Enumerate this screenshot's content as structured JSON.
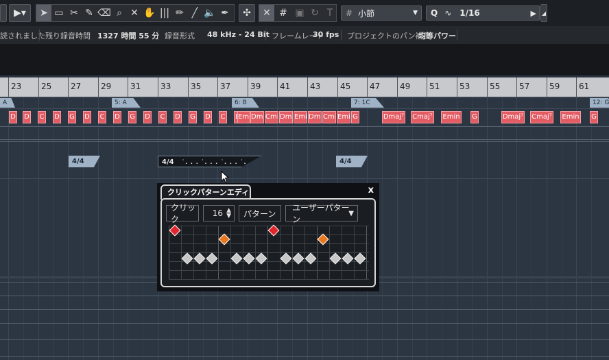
{
  "toolbar": {
    "quantize_label": "Q",
    "quantize_value": "1/16",
    "grid_label": "小節",
    "icons": [
      "route-icon",
      "pointer-icon",
      "range-icon",
      "split-icon",
      "glue-icon",
      "erase-icon",
      "zoom-icon",
      "mute-icon",
      "time-warp-icon",
      "comp-icon",
      "draw-icon",
      "line-icon",
      "play-icon",
      "audition-icon",
      "snap-icon",
      "snap-grid-icon",
      "cursor-snap-icon",
      "auto-scroll-icon",
      "quantize-icon",
      "iterative-icon",
      "play-button-icon"
    ]
  },
  "status": {
    "record_done": "読されました",
    "remaining_label": "残り録音時間",
    "remaining_value": "1327 時間 55 分",
    "format_label": "録音形式",
    "format_value": "48 kHz - 24 Bit",
    "framerate_label": "フレームレート",
    "framerate_value": "30 fps",
    "pan_label": "プロジェクトのパン補正",
    "pan_value": "均等パワー"
  },
  "ruler": {
    "bars": [
      "23",
      "25",
      "27",
      "29",
      "31",
      "33",
      "35",
      "37",
      "39",
      "41",
      "43",
      "45",
      "47",
      "49",
      "51",
      "53",
      "55",
      "57",
      "59",
      "61"
    ]
  },
  "markers": [
    {
      "label": "A"
    },
    {
      "label": "5: A"
    },
    {
      "label": "6: B"
    },
    {
      "label": "7: 1C"
    },
    {
      "label": "12: G"
    }
  ],
  "chords": [
    "D",
    "D",
    "C",
    "D",
    "G",
    "D",
    "C",
    "D",
    "G",
    "D",
    "C",
    "D",
    "G",
    "D",
    "C",
    "D",
    "Emi",
    "Dmi",
    "Cmi",
    "Dmi",
    "Emi",
    "Dmi",
    "Cmi",
    "Emi",
    "G",
    "Dmaj⁷",
    "Cmaj⁷",
    "Emin",
    "G",
    "Dmaj⁷",
    "Cmaj⁷",
    "Emin",
    "G"
  ],
  "signatures": [
    {
      "label": "4/4"
    },
    {
      "label": "4/4",
      "pattern": "˙. . . ˙. . . ˙. . . ˙. . ."
    },
    {
      "label": "4/4"
    }
  ],
  "popup": {
    "tab_title": "クリックパターンエディター",
    "close_label": "x",
    "click_label": "クリック",
    "click_value": "16",
    "pattern_label": "パターン",
    "pattern_value": "ユーザーパターン",
    "accent_color_high": "#e0262c",
    "accent_color_mid": "#e8771e",
    "normal_color": "#c7c7c7",
    "steps": [
      "high",
      "off",
      "off",
      "off",
      "mid",
      "off",
      "off",
      "off",
      "high",
      "off",
      "off",
      "off",
      "mid",
      "off",
      "off",
      "off"
    ],
    "normal_steps": [
      1,
      1,
      1,
      0,
      1,
      1,
      1,
      0,
      1,
      1,
      1,
      0,
      1,
      1,
      1,
      0
    ]
  }
}
